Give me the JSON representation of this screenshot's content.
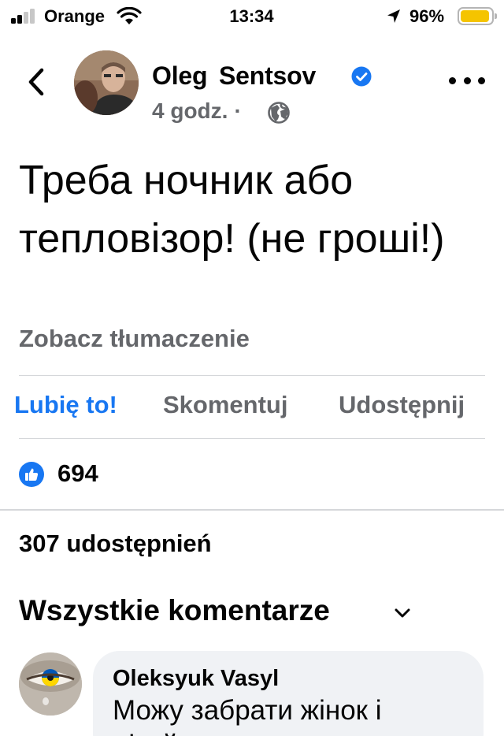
{
  "status_bar": {
    "carrier": "Orange",
    "time": "13:34",
    "battery_percent": "96%",
    "signal_bars": 2,
    "battery_level": 0.96,
    "battery_color": "#f5c400"
  },
  "header": {
    "back_icon": "chevron-left-icon",
    "author_name": "Oleg Sentsov",
    "verified_icon": "verified-badge-icon",
    "time_ago": "4 godz.",
    "separator": "·",
    "privacy_icon": "globe-icon",
    "more_icon": "more-horizontal-icon"
  },
  "post": {
    "text": "Треба ночник або тепловізор! (не гроші!)",
    "translate_label": "Zobacz tłumaczenie"
  },
  "actions": {
    "like_label": "Lubię to!",
    "comment_label": "Skomentuj",
    "share_label": "Udostępnij"
  },
  "reactions": {
    "icon": "like-thumb-icon",
    "count": "694"
  },
  "shares": {
    "label": "307 udostępnień"
  },
  "comments": {
    "filter_label": "Wszystkie komentarze",
    "filter_icon": "chevron-down-icon",
    "items": [
      {
        "author": "Oleksyuk Vasyl",
        "text_line_1": "Можу забрати жінок і",
        "text_line_2": "дітей з..."
      }
    ]
  },
  "colors": {
    "accent": "#1877f2",
    "secondary_text": "#65676b",
    "divider": "#d5d7da",
    "comment_bubble": "#f0f2f5"
  }
}
